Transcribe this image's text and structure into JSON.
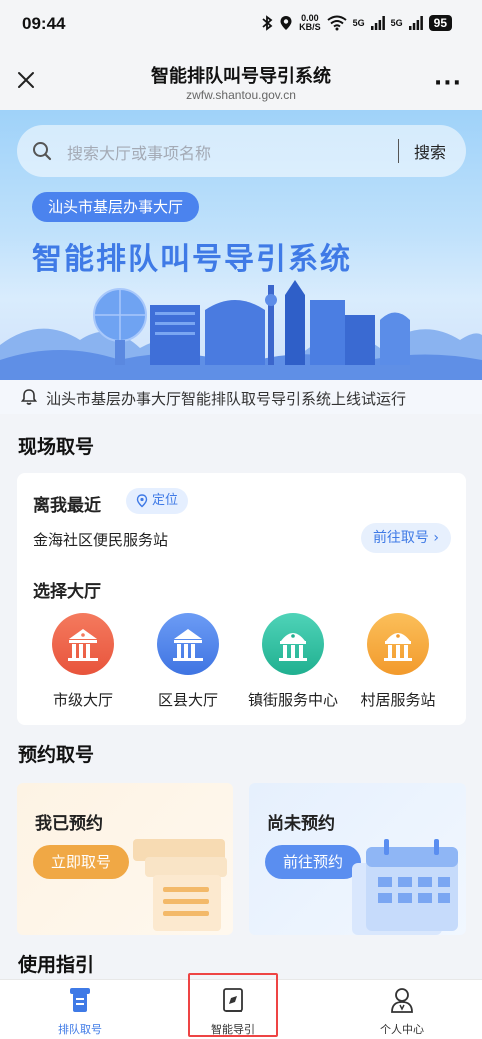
{
  "status_bar": {
    "time": "09:44",
    "net_speed_top": "0.00",
    "net_speed_bottom": "KB/S",
    "signal_1": "5G",
    "signal_2": "5G",
    "battery": "95"
  },
  "title_bar": {
    "title": "智能排队叫号导引系统",
    "subtitle": "zwfw.shantou.gov.cn",
    "more_label": "···"
  },
  "banner": {
    "search_placeholder": "搜索大厅或事项名称",
    "search_button": "搜索",
    "hall_chip": "汕头市基层办事大厅",
    "title": "智能排队叫号导引系统"
  },
  "notice": {
    "text": "汕头市基层办事大厅智能排队取号导引系统上线试运行"
  },
  "onsite": {
    "section_title": "现场取号",
    "nearest_label": "离我最近",
    "locate_label": "定位",
    "station_name": "金海社区便民服务站",
    "goto_ticket_label": "前往取号",
    "select_hall_label": "选择大厅",
    "halls": [
      {
        "label": "市级大厅",
        "color_top": "#f47a5e",
        "color_bottom": "#e8543c"
      },
      {
        "label": "区县大厅",
        "color_top": "#6c9cf5",
        "color_bottom": "#3f74e2"
      },
      {
        "label": "镇街服务中心",
        "color_top": "#4fd3b8",
        "color_bottom": "#20b090"
      },
      {
        "label": "村居服务站",
        "color_top": "#fbbf5a",
        "color_bottom": "#f29a2c"
      }
    ]
  },
  "appointment": {
    "section_title": "预约取号",
    "booked_title": "我已预约",
    "booked_button": "立即取号",
    "unbooked_title": "尚未预约",
    "unbooked_button": "前往预约"
  },
  "guide": {
    "section_title": "使用指引"
  },
  "tabs": [
    {
      "label": "排队取号",
      "icon": "queue-ticket-icon",
      "active": true
    },
    {
      "label": "智能导引",
      "icon": "compass-book-icon",
      "active": false
    },
    {
      "label": "个人中心",
      "icon": "user-icon",
      "active": false
    }
  ],
  "colors": {
    "accent": "#3f7ae6",
    "orange": "#f0a845",
    "highlight_border": "#e44444"
  }
}
